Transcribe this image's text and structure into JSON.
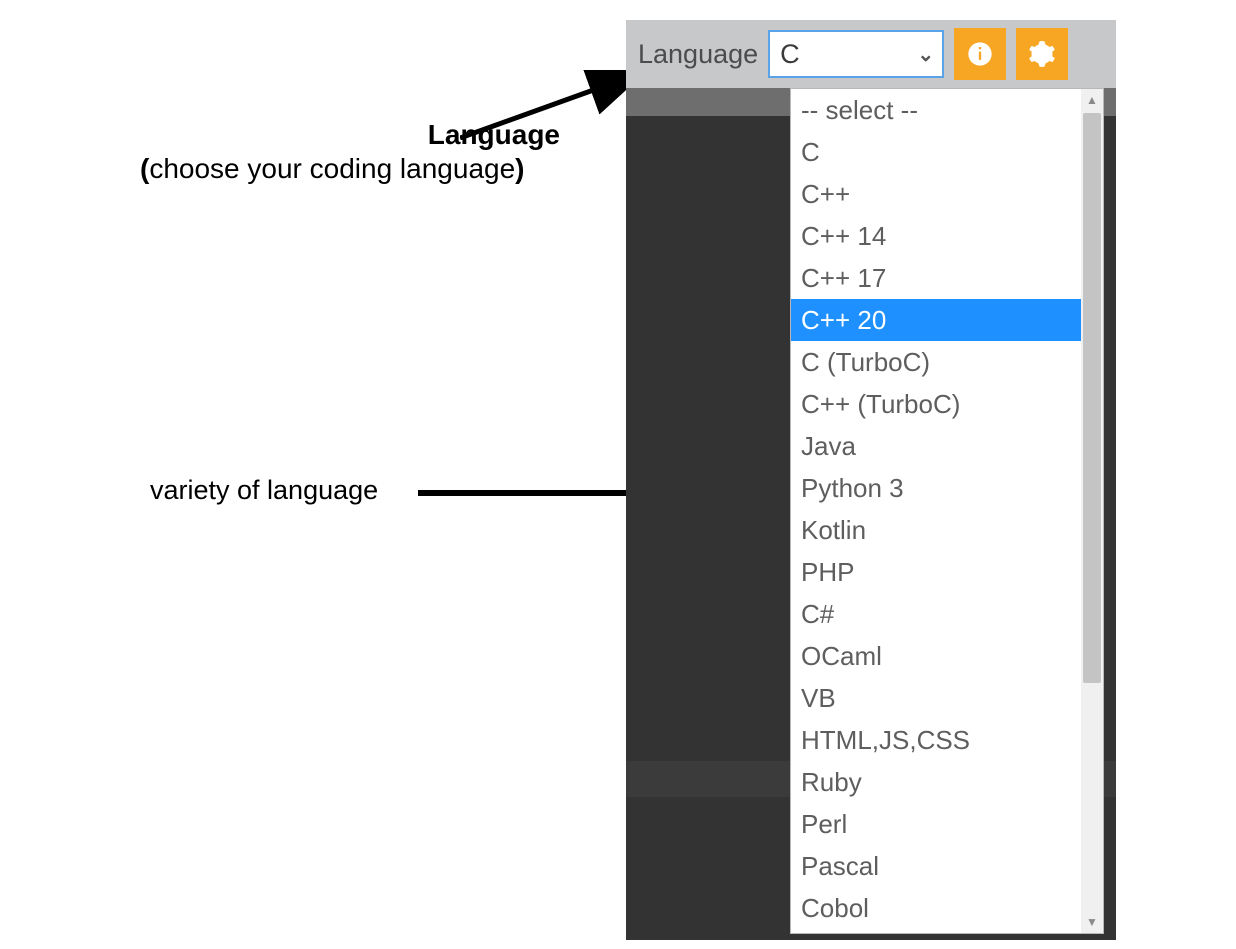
{
  "annotations": {
    "lang_title": "Language",
    "lang_sub_open": "(",
    "lang_sub_text": "choose your coding language",
    "lang_sub_close": ")",
    "variety_label": "variety of  language"
  },
  "toolbar": {
    "language_label": "Language",
    "selected_value": "C",
    "info_icon": "info-icon",
    "gear_icon": "gear-icon"
  },
  "dropdown": {
    "options": [
      "-- select --",
      "C",
      "C++",
      "C++ 14",
      "C++ 17",
      "C++ 20",
      "C (TurboC)",
      "C++ (TurboC)",
      "Java",
      "Python 3",
      "Kotlin",
      "PHP",
      "C#",
      "OCaml",
      "VB",
      "HTML,JS,CSS",
      "Ruby",
      "Perl",
      "Pascal",
      "Cobol"
    ],
    "highlighted_index": 5
  }
}
